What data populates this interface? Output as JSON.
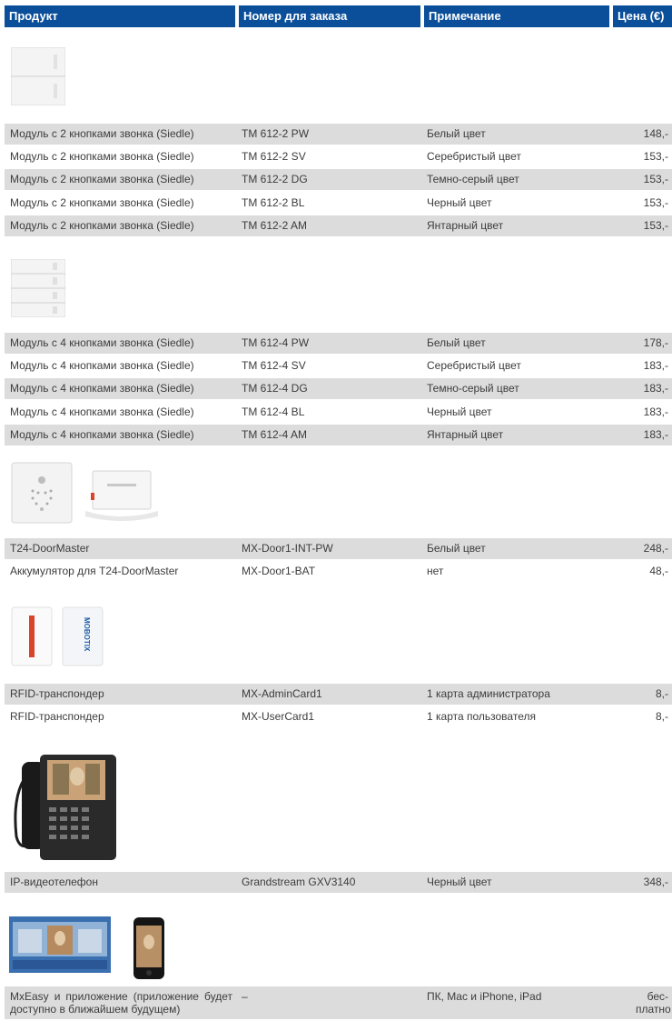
{
  "header": {
    "col1": "Продукт",
    "col2": "Номер для заказа",
    "col3": "Примечание",
    "col4": "Цена (€)"
  },
  "groups": [
    {
      "rows": [
        [
          "Модуль с 2 кнопками звонка (Siedle)",
          "TM 612-2 PW",
          "Белый цвет",
          "148,-"
        ],
        [
          "Модуль с 2 кнопками звонка (Siedle)",
          "TM 612-2 SV",
          "Серебристый цвет",
          "153,-"
        ],
        [
          "Модуль с 2 кнопками звонка (Siedle)",
          "TM 612-2 DG",
          "Темно-серый цвет",
          "153,-"
        ],
        [
          "Модуль с 2 кнопками звонка (Siedle)",
          "TM 612-2 BL",
          "Черный цвет",
          "153,-"
        ],
        [
          "Модуль с 2 кнопками звонка (Siedle)",
          "TM 612-2 AM",
          "Янтарный цвет",
          "153,-"
        ]
      ]
    },
    {
      "rows": [
        [
          "Модуль с 4 кнопками звонка (Siedle)",
          "TM 612-4 PW",
          "Белый цвет",
          "178,-"
        ],
        [
          "Модуль с 4 кнопками звонка (Siedle)",
          "TM 612-4 SV",
          "Серебристый цвет",
          "183,-"
        ],
        [
          "Модуль с 4 кнопками звонка (Siedle)",
          "TM 612-4 DG",
          "Темно-серый цвет",
          "183,-"
        ],
        [
          "Модуль с 4 кнопками звонка (Siedle)",
          "TM 612-4 BL",
          "Черный цвет",
          "183,-"
        ],
        [
          "Модуль с 4 кнопками звонка (Siedle)",
          "TM 612-4 AM",
          "Янтарный цвет",
          "183,-"
        ]
      ]
    },
    {
      "rows": [
        [
          "T24-DoorMaster",
          "MX-Door1-INT-PW",
          "Белый цвет",
          "248,-"
        ],
        [
          "Аккумулятор для T24-DoorMaster",
          "MX-Door1-BAT",
          "нет",
          "48,-"
        ]
      ]
    },
    {
      "rows": [
        [
          "RFID-транспондер",
          "MX-AdminCard1",
          "1 карта администратора",
          "8,-"
        ],
        [
          "RFID-транспондер",
          "MX-UserCard1",
          "1 карта пользователя",
          "8,-"
        ]
      ]
    },
    {
      "rows": [
        [
          "IP-видеотелефон",
          "Grandstream GXV3140",
          "Черный цвет",
          "348,-"
        ]
      ]
    },
    {
      "rows": [
        [
          "MxEasy и приложение (приложение будет доступно в ближайшем будущем)",
          "–",
          "ПК, Mac и iPhone, iPad",
          "бес-платно"
        ]
      ]
    }
  ],
  "images": {
    "card_brand": "MOBOTIX"
  },
  "colors": {
    "header_bg": "#0b4f9a",
    "row_shade": "#dcdcdc",
    "card_stripe": "#d9442a"
  }
}
